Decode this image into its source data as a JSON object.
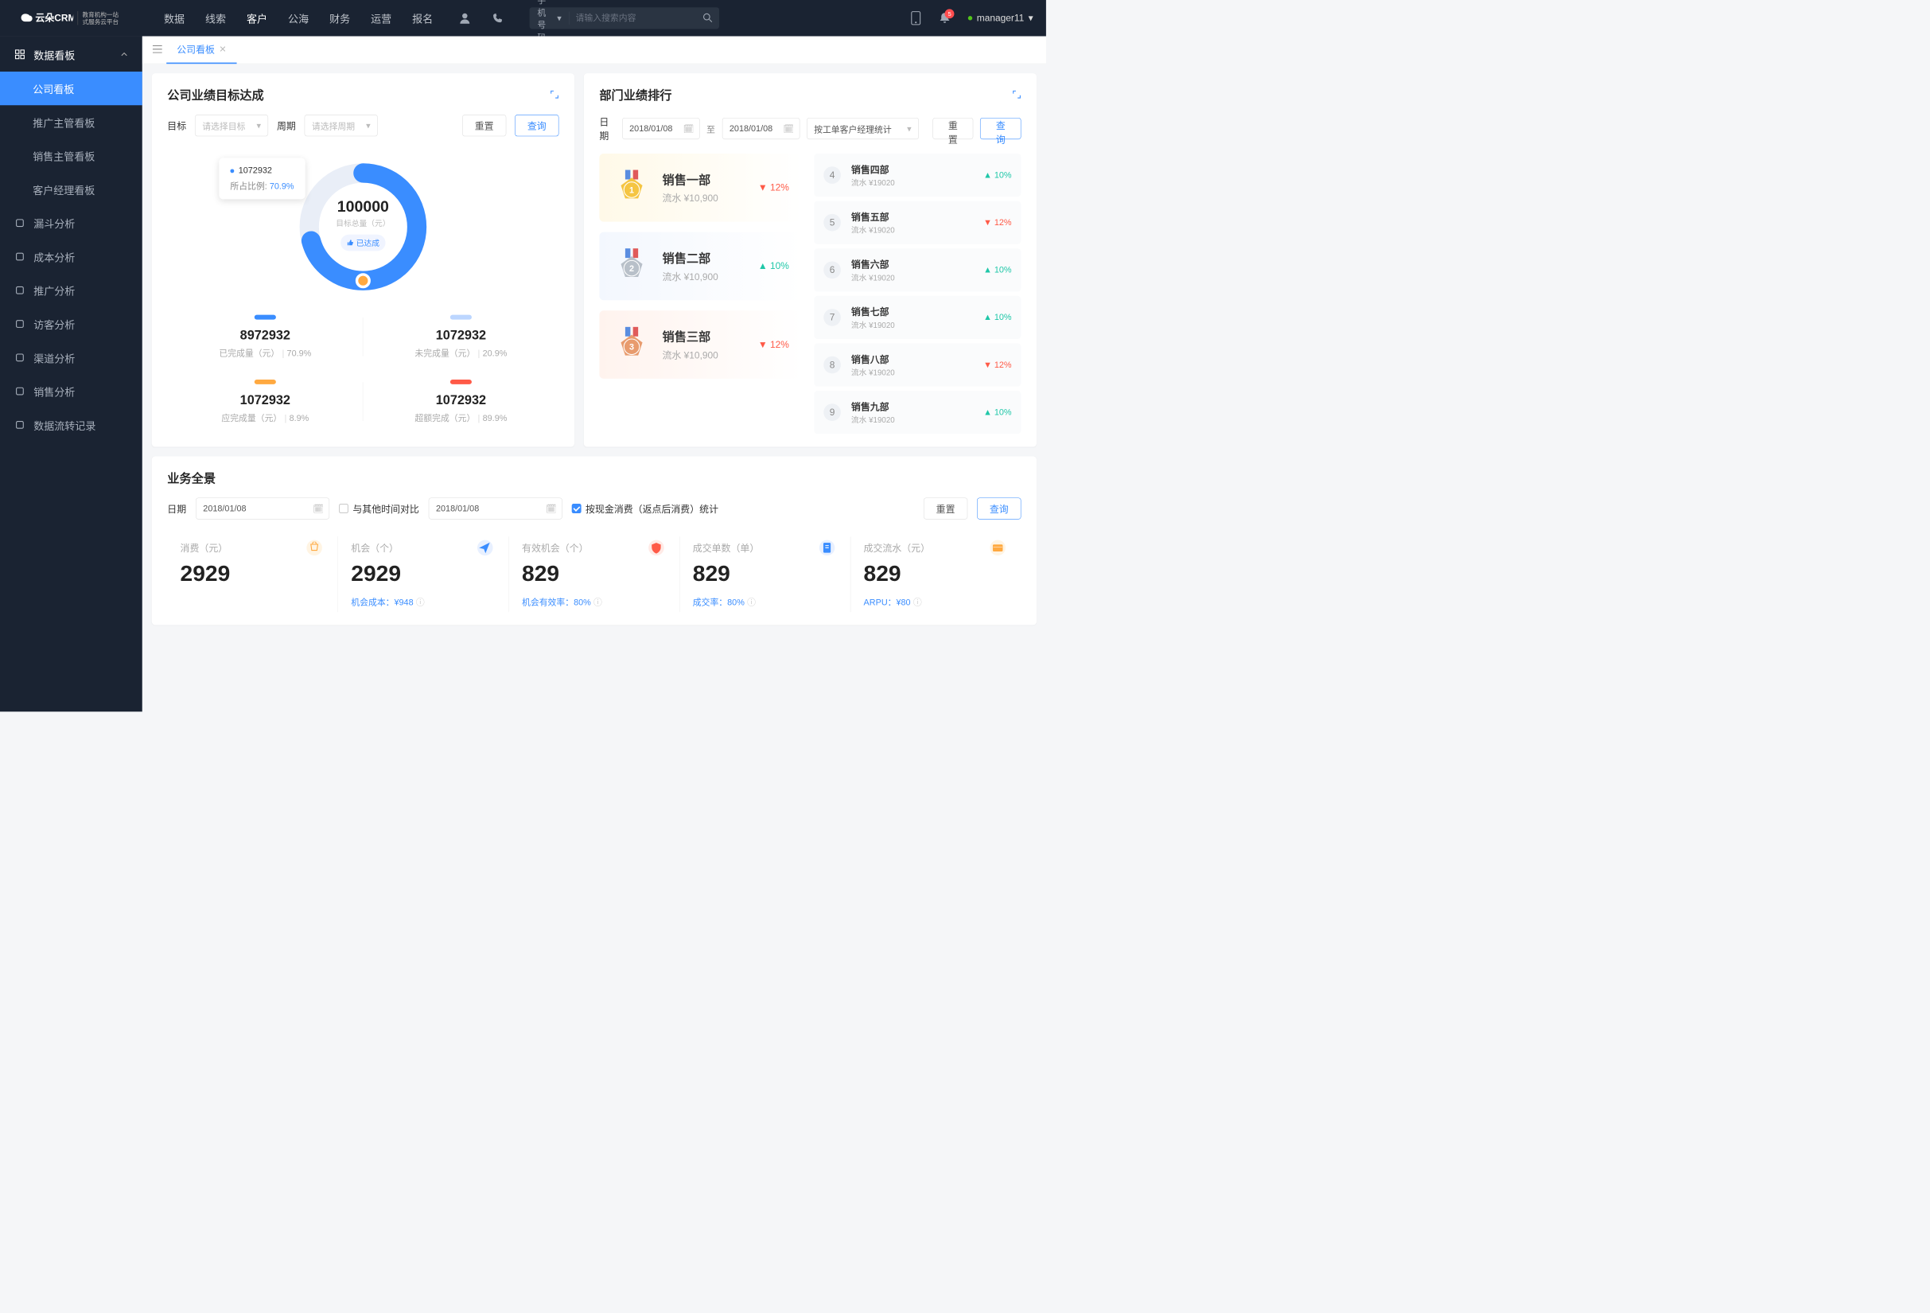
{
  "brand": {
    "sub1": "教育机构一站",
    "sub2": "式服务云平台"
  },
  "topnav": [
    "数据",
    "线索",
    "客户",
    "公海",
    "财务",
    "运营",
    "报名"
  ],
  "topnav_active": 2,
  "search": {
    "type": "手机号码",
    "placeholder": "请输入搜索内容"
  },
  "notif_count": "5",
  "user": "manager11",
  "side_header": "数据看板",
  "side_items": [
    "公司看板",
    "推广主管看板",
    "销售主管看板",
    "客户经理看板"
  ],
  "side_active": 0,
  "side_nav": [
    "漏斗分析",
    "成本分析",
    "推广分析",
    "访客分析",
    "渠道分析",
    "销售分析",
    "数据流转记录"
  ],
  "tab": "公司看板",
  "goal": {
    "title": "公司业绩目标达成",
    "labels": {
      "target": "目标",
      "period": "周期",
      "target_ph": "请选择目标",
      "period_ph": "请选择周期",
      "reset": "重置",
      "query": "查询"
    },
    "tooltip": {
      "value": "1072932",
      "ratio_l": "所占比例:",
      "ratio_v": "70.9%"
    },
    "center": {
      "value": "100000",
      "label": "目标总量（元）",
      "badge": "已达成"
    },
    "stats": [
      {
        "bar": "b-blue",
        "v": "8972932",
        "l": "已完成量（元）",
        "p": "70.9%"
      },
      {
        "bar": "b-lite",
        "v": "1072932",
        "l": "未完成量（元）",
        "p": "20.9%"
      },
      {
        "bar": "b-org",
        "v": "1072932",
        "l": "应完成量（元）",
        "p": "8.9%"
      },
      {
        "bar": "b-red",
        "v": "1072932",
        "l": "超额完成（元）",
        "p": "89.9%"
      }
    ]
  },
  "rank": {
    "title": "部门业绩排行",
    "labels": {
      "date": "日期",
      "to": "至",
      "by_ph": "按工单客户经理统计",
      "reset": "重置",
      "query": "查询"
    },
    "date_from": "2018/01/08",
    "date_to": "2018/01/08",
    "top3": [
      {
        "name": "销售一部",
        "amt": "流水 ¥10,900",
        "pct": "12%",
        "dir": "down"
      },
      {
        "name": "销售二部",
        "amt": "流水 ¥10,900",
        "pct": "10%",
        "dir": "up"
      },
      {
        "name": "销售三部",
        "amt": "流水 ¥10,900",
        "pct": "12%",
        "dir": "down"
      }
    ],
    "list": [
      {
        "n": "4",
        "name": "销售四部",
        "amt": "流水 ¥19020",
        "pct": "10%",
        "dir": "up"
      },
      {
        "n": "5",
        "name": "销售五部",
        "amt": "流水 ¥19020",
        "pct": "12%",
        "dir": "down"
      },
      {
        "n": "6",
        "name": "销售六部",
        "amt": "流水 ¥19020",
        "pct": "10%",
        "dir": "up"
      },
      {
        "n": "7",
        "name": "销售七部",
        "amt": "流水 ¥19020",
        "pct": "10%",
        "dir": "up"
      },
      {
        "n": "8",
        "name": "销售八部",
        "amt": "流水 ¥19020",
        "pct": "12%",
        "dir": "down"
      },
      {
        "n": "9",
        "name": "销售九部",
        "amt": "流水 ¥19020",
        "pct": "10%",
        "dir": "up"
      }
    ]
  },
  "ov": {
    "title": "业务全景",
    "labels": {
      "date": "日期",
      "compare": "与其他时间对比",
      "by_cash": "按现金消费（返点后消费）统计",
      "reset": "重置",
      "query": "查询"
    },
    "date1": "2018/01/08",
    "date2": "2018/01/08",
    "items": [
      {
        "label": "消费（元）",
        "value": "2929",
        "sub": "",
        "icon": "bag",
        "bg": "ic-org",
        "c": "#ffa940"
      },
      {
        "label": "机会（个）",
        "value": "2929",
        "sub": "机会成本：¥948",
        "icon": "send",
        "bg": "ic-blu",
        "c": "#3a8dff"
      },
      {
        "label": "有效机会（个）",
        "value": "829",
        "sub": "机会有效率：80%",
        "icon": "shield",
        "bg": "ic-red",
        "c": "#ff5a47"
      },
      {
        "label": "成交单数（单）",
        "value": "829",
        "sub": "成交率：80%",
        "icon": "doc",
        "bg": "ic-blu",
        "c": "#3a8dff"
      },
      {
        "label": "成交流水（元）",
        "value": "829",
        "sub": "ARPU：¥80",
        "icon": "card",
        "bg": "ic-org",
        "c": "#ffa940"
      }
    ]
  },
  "chart_data": {
    "type": "pie",
    "title": "公司业绩目标达成",
    "total": 100000,
    "series": [
      {
        "name": "已完成量",
        "value": 8972932,
        "pct": 70.9
      },
      {
        "name": "未完成量",
        "value": 1072932,
        "pct": 20.9
      }
    ]
  }
}
